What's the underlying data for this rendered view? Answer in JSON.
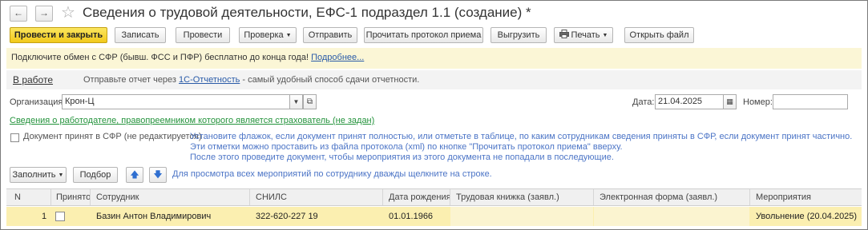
{
  "window": {
    "back_arrow": "←",
    "forward_arrow": "→",
    "star": "☆",
    "title": "Сведения о трудовой деятельности, ЕФС-1 подраздел 1.1 (создание) *"
  },
  "toolbar": {
    "post_close": "Провести и закрыть",
    "save": "Записать",
    "post": "Провести",
    "check": "Проверка",
    "send": "Отправить",
    "read_protocol": "Прочитать протокол приема",
    "upload": "Выгрузить",
    "print": "Печать",
    "open_file": "Открыть файл"
  },
  "banner": {
    "text": "Подключите обмен с СФР (бывш. ФСС и ПФР) бесплатно до конца года!",
    "link": "Подробнее..."
  },
  "status": {
    "state": "В работе",
    "text_before": "Отправьте отчет через",
    "link": "1С-Отчетность",
    "text_after": "- самый удобный способ сдачи отчетности."
  },
  "form": {
    "org_label": "Организация:",
    "org_value": "Крон-Ц",
    "date_label": "Дата:",
    "date_value": "21.04.2025",
    "number_label": "Номер:",
    "number_value": "",
    "successor_link": "Сведения о работодателе, правопреемником которого является страхователь (не задан)",
    "accepted_checkbox_label": "Документ принят в СФР (не редактируется)",
    "accepted_checked": false,
    "hint_lines": [
      "Установите флажок, если документ принят полностью, или отметьте в таблице, по каким сотрудникам сведения приняты в СФР, если документ принят частично.",
      "Эти отметки можно проставить из файла протокола (xml) по кнопке \"Прочитать протокол приема\" вверху.",
      "После этого проведите документ, чтобы мероприятия из этого документа не попадали в последующие."
    ]
  },
  "table_toolbar": {
    "fill": "Заполнить",
    "select": "Подбор",
    "hint": "Для просмотра всех мероприятий по сотруднику дважды щелкните на строке."
  },
  "table": {
    "columns": [
      "N",
      "Принято",
      "Сотрудник",
      "СНИЛС",
      "Дата рождения",
      "Трудовая книжка (заявл.)",
      "Электронная форма (заявл.)",
      "Мероприятия"
    ],
    "rows": [
      {
        "n": "1",
        "accepted": false,
        "employee": "Базин Антон Владимирович",
        "snils": "322-620-227 19",
        "birth_date": "01.01.1966",
        "labor_book": "",
        "electronic_form": "",
        "events": "Увольнение (20.04.2025)"
      }
    ]
  },
  "colors": {
    "primary_button": "#f2c91a",
    "banner_bg": "#fbf6d6",
    "selected_row": "#fbefb0",
    "link_blue": "#2a5ba8",
    "link_green": "#24933c",
    "hint_blue": "#4b74c6"
  }
}
